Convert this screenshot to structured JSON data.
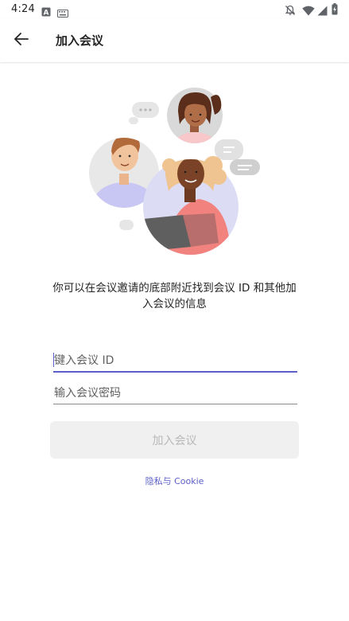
{
  "status_bar": {
    "time": "4:24",
    "left_icons": [
      "notification-a-icon",
      "keyboard-icon"
    ],
    "right_icons": [
      "notifications-off-icon",
      "wifi-icon",
      "signal-icon",
      "battery-icon"
    ]
  },
  "app_bar": {
    "title": "加入会议",
    "back_icon": "arrow-left-icon"
  },
  "main": {
    "description": "你可以在会议邀请的底部附近找到会议 ID 和其他加入会议的信息",
    "meeting_id_placeholder": "键入会议 ID",
    "meeting_id_value": "",
    "password_placeholder": "输入会议密码",
    "password_value": "",
    "join_button_label": "加入会议",
    "privacy_link": "隐私与 Cookie"
  },
  "colors": {
    "accent": "#5b5fc7",
    "button_disabled_bg": "#f0f0f0",
    "button_disabled_text": "#b8b8b8",
    "text_primary": "#242424"
  }
}
